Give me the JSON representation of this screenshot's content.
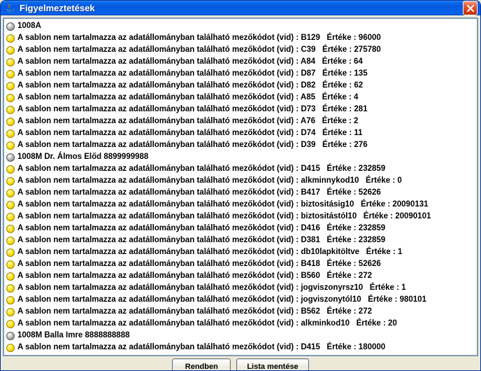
{
  "window": {
    "title": "Figyelmeztetések"
  },
  "buttons": {
    "ok": "Rendben",
    "save_list": "Lista mentése"
  },
  "message_template": "A sablon nem tartalmazza az adatállományban található mezőkódot (vid) :",
  "value_label": "Értéke :",
  "groups": [
    {
      "header": "1008A",
      "rows": [
        {
          "code": "B129",
          "value": "96000"
        },
        {
          "code": "C39",
          "value": "275780"
        },
        {
          "code": "A84",
          "value": "64"
        },
        {
          "code": "D87",
          "value": "135"
        },
        {
          "code": "D82",
          "value": "62"
        },
        {
          "code": "A85",
          "value": "4"
        },
        {
          "code": "D73",
          "value": "281"
        },
        {
          "code": "A76",
          "value": "2"
        },
        {
          "code": "D74",
          "value": "11"
        },
        {
          "code": "D39",
          "value": "276"
        }
      ]
    },
    {
      "header": "1008M Dr. Álmos Előd 8899999988",
      "rows": [
        {
          "code": "D415",
          "value": "232859"
        },
        {
          "code": "alkminnykod10",
          "value": "0"
        },
        {
          "code": "B417",
          "value": "52626"
        },
        {
          "code": "biztositásig10",
          "value": "20090131"
        },
        {
          "code": "biztositástól10",
          "value": "20090101"
        },
        {
          "code": "D416",
          "value": "232859"
        },
        {
          "code": "D381",
          "value": "232859"
        },
        {
          "code": "db10lapkitöltve",
          "value": "1"
        },
        {
          "code": "B418",
          "value": "52626"
        },
        {
          "code": "B560",
          "value": "272"
        },
        {
          "code": "jogviszonyrsz10",
          "value": "1"
        },
        {
          "code": "jogviszonytól10",
          "value": "980101"
        },
        {
          "code": "B562",
          "value": "272"
        },
        {
          "code": "alkminkod10",
          "value": "20"
        }
      ]
    },
    {
      "header": "1008M Balla Imre 8888888888",
      "rows": [
        {
          "code": "D415",
          "value": "180000"
        }
      ]
    }
  ]
}
